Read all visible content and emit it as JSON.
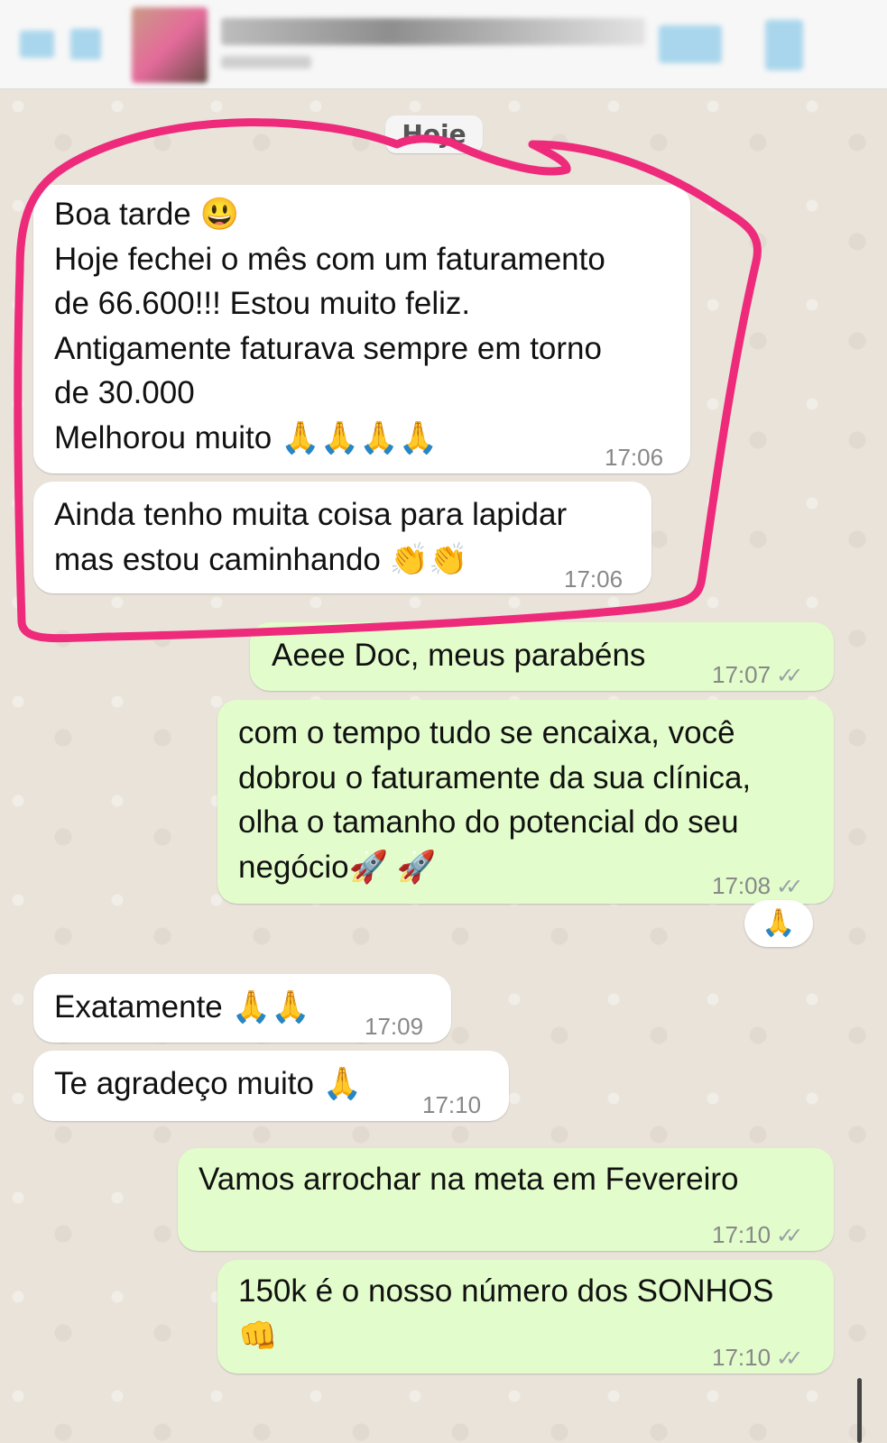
{
  "header": {
    "back_icon": "back-arrow-icon",
    "video_icon": "video-call-icon",
    "call_icon": "phone-call-icon"
  },
  "date_chip": "Hoje",
  "messages": [
    {
      "dir": "in",
      "text": "Boa tarde 😃\nHoje fechei o mês com um faturamento\nde 66.600!!! Estou muito feliz.\nAntigamente faturava sempre em torno\nde 30.000\nMelhorou muito 🙏🙏🙏🙏",
      "time": "17:06"
    },
    {
      "dir": "in",
      "text": "Ainda tenho muita coisa para lapidar\nmas estou caminhando 👏👏",
      "time": "17:06"
    },
    {
      "dir": "out",
      "text": "Aeee Doc, meus parabéns",
      "time": "17:07"
    },
    {
      "dir": "out",
      "text": "com o tempo tudo se encaixa, você\ndobrou o faturamente da sua clínica,\nolha o tamanho do potencial do seu\nnegócio🚀 🚀",
      "time": "17:08"
    },
    {
      "dir": "in",
      "text": "Exatamente 🙏🙏",
      "time": "17:09"
    },
    {
      "dir": "in",
      "text": "Te agradeço muito 🙏",
      "time": "17:10"
    },
    {
      "dir": "out",
      "text": "Vamos arrochar na meta em Fevereiro",
      "time": "17:10"
    },
    {
      "dir": "out",
      "text": "150k é o nosso número dos SONHOS\n👊",
      "time": "17:10"
    }
  ],
  "reaction": "🙏",
  "ticks": "✓✓",
  "colors": {
    "incoming": "#ffffff",
    "outgoing": "#e2fdcb",
    "highlight": "#ee2a7b",
    "background": "#ece5dd"
  }
}
